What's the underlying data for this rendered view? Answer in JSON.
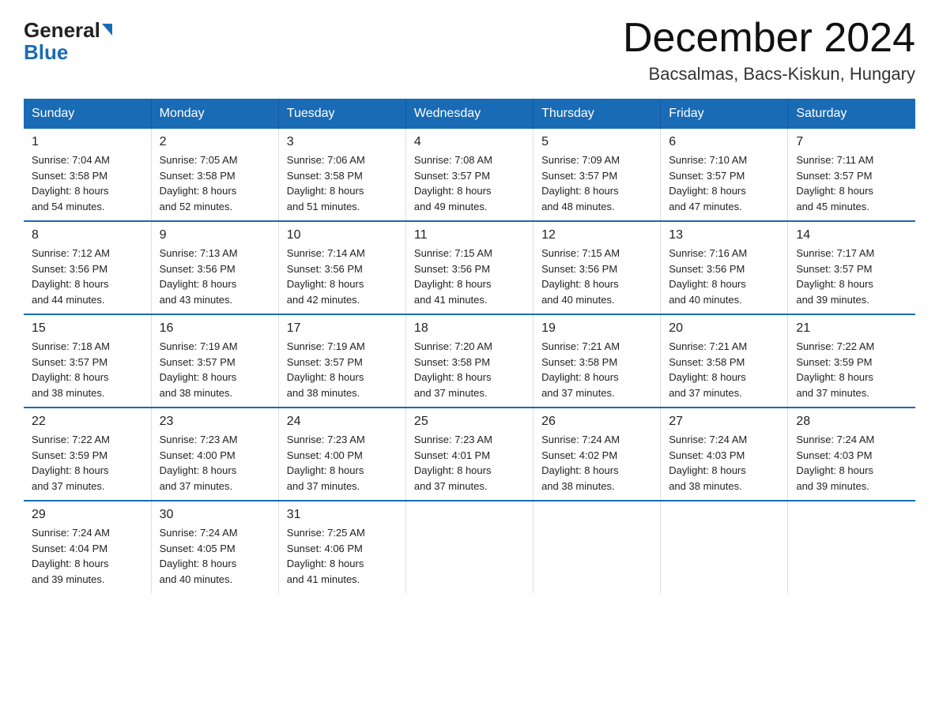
{
  "logo": {
    "text_general": "General",
    "text_blue": "Blue",
    "arrow": "▲"
  },
  "header": {
    "title": "December 2024",
    "subtitle": "Bacsalmas, Bacs-Kiskun, Hungary"
  },
  "columns": [
    "Sunday",
    "Monday",
    "Tuesday",
    "Wednesday",
    "Thursday",
    "Friday",
    "Saturday"
  ],
  "weeks": [
    [
      {
        "day": "1",
        "sunrise": "7:04 AM",
        "sunset": "3:58 PM",
        "daylight": "8 hours and 54 minutes."
      },
      {
        "day": "2",
        "sunrise": "7:05 AM",
        "sunset": "3:58 PM",
        "daylight": "8 hours and 52 minutes."
      },
      {
        "day": "3",
        "sunrise": "7:06 AM",
        "sunset": "3:58 PM",
        "daylight": "8 hours and 51 minutes."
      },
      {
        "day": "4",
        "sunrise": "7:08 AM",
        "sunset": "3:57 PM",
        "daylight": "8 hours and 49 minutes."
      },
      {
        "day": "5",
        "sunrise": "7:09 AM",
        "sunset": "3:57 PM",
        "daylight": "8 hours and 48 minutes."
      },
      {
        "day": "6",
        "sunrise": "7:10 AM",
        "sunset": "3:57 PM",
        "daylight": "8 hours and 47 minutes."
      },
      {
        "day": "7",
        "sunrise": "7:11 AM",
        "sunset": "3:57 PM",
        "daylight": "8 hours and 45 minutes."
      }
    ],
    [
      {
        "day": "8",
        "sunrise": "7:12 AM",
        "sunset": "3:56 PM",
        "daylight": "8 hours and 44 minutes."
      },
      {
        "day": "9",
        "sunrise": "7:13 AM",
        "sunset": "3:56 PM",
        "daylight": "8 hours and 43 minutes."
      },
      {
        "day": "10",
        "sunrise": "7:14 AM",
        "sunset": "3:56 PM",
        "daylight": "8 hours and 42 minutes."
      },
      {
        "day": "11",
        "sunrise": "7:15 AM",
        "sunset": "3:56 PM",
        "daylight": "8 hours and 41 minutes."
      },
      {
        "day": "12",
        "sunrise": "7:15 AM",
        "sunset": "3:56 PM",
        "daylight": "8 hours and 40 minutes."
      },
      {
        "day": "13",
        "sunrise": "7:16 AM",
        "sunset": "3:56 PM",
        "daylight": "8 hours and 40 minutes."
      },
      {
        "day": "14",
        "sunrise": "7:17 AM",
        "sunset": "3:57 PM",
        "daylight": "8 hours and 39 minutes."
      }
    ],
    [
      {
        "day": "15",
        "sunrise": "7:18 AM",
        "sunset": "3:57 PM",
        "daylight": "8 hours and 38 minutes."
      },
      {
        "day": "16",
        "sunrise": "7:19 AM",
        "sunset": "3:57 PM",
        "daylight": "8 hours and 38 minutes."
      },
      {
        "day": "17",
        "sunrise": "7:19 AM",
        "sunset": "3:57 PM",
        "daylight": "8 hours and 38 minutes."
      },
      {
        "day": "18",
        "sunrise": "7:20 AM",
        "sunset": "3:58 PM",
        "daylight": "8 hours and 37 minutes."
      },
      {
        "day": "19",
        "sunrise": "7:21 AM",
        "sunset": "3:58 PM",
        "daylight": "8 hours and 37 minutes."
      },
      {
        "day": "20",
        "sunrise": "7:21 AM",
        "sunset": "3:58 PM",
        "daylight": "8 hours and 37 minutes."
      },
      {
        "day": "21",
        "sunrise": "7:22 AM",
        "sunset": "3:59 PM",
        "daylight": "8 hours and 37 minutes."
      }
    ],
    [
      {
        "day": "22",
        "sunrise": "7:22 AM",
        "sunset": "3:59 PM",
        "daylight": "8 hours and 37 minutes."
      },
      {
        "day": "23",
        "sunrise": "7:23 AM",
        "sunset": "4:00 PM",
        "daylight": "8 hours and 37 minutes."
      },
      {
        "day": "24",
        "sunrise": "7:23 AM",
        "sunset": "4:00 PM",
        "daylight": "8 hours and 37 minutes."
      },
      {
        "day": "25",
        "sunrise": "7:23 AM",
        "sunset": "4:01 PM",
        "daylight": "8 hours and 37 minutes."
      },
      {
        "day": "26",
        "sunrise": "7:24 AM",
        "sunset": "4:02 PM",
        "daylight": "8 hours and 38 minutes."
      },
      {
        "day": "27",
        "sunrise": "7:24 AM",
        "sunset": "4:03 PM",
        "daylight": "8 hours and 38 minutes."
      },
      {
        "day": "28",
        "sunrise": "7:24 AM",
        "sunset": "4:03 PM",
        "daylight": "8 hours and 39 minutes."
      }
    ],
    [
      {
        "day": "29",
        "sunrise": "7:24 AM",
        "sunset": "4:04 PM",
        "daylight": "8 hours and 39 minutes."
      },
      {
        "day": "30",
        "sunrise": "7:24 AM",
        "sunset": "4:05 PM",
        "daylight": "8 hours and 40 minutes."
      },
      {
        "day": "31",
        "sunrise": "7:25 AM",
        "sunset": "4:06 PM",
        "daylight": "8 hours and 41 minutes."
      },
      null,
      null,
      null,
      null
    ]
  ],
  "labels": {
    "sunrise": "Sunrise:",
    "sunset": "Sunset:",
    "daylight": "Daylight:"
  }
}
